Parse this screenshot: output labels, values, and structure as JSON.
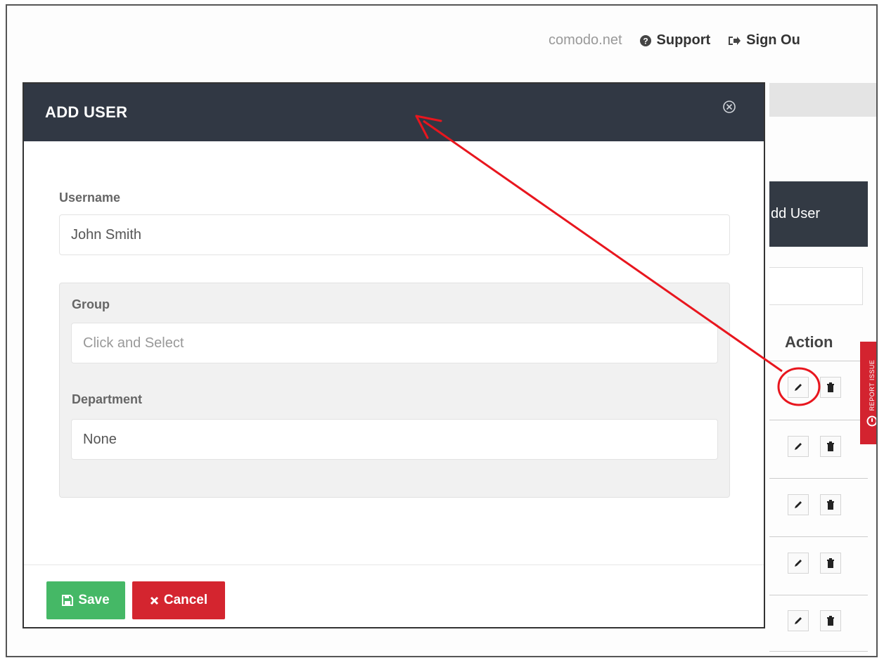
{
  "topnav": {
    "domain": "comodo.net",
    "support_label": "Support",
    "signout_label": "Sign Ou"
  },
  "background": {
    "add_user_label": "dd User",
    "action_header": "Action",
    "report_issue_label": "REPORT ISSUE",
    "row_count": 5
  },
  "modal": {
    "title": "ADD USER",
    "username": {
      "label": "Username",
      "value": "John Smith"
    },
    "group": {
      "label": "Group",
      "placeholder": "Click and Select"
    },
    "department": {
      "label": "Department",
      "value": "None"
    },
    "save_label": "Save",
    "cancel_label": "Cancel"
  },
  "colors": {
    "modal_header": "#313844",
    "save": "#45b866",
    "cancel": "#d4252f",
    "report": "#d3232f",
    "annotation": "#e8161e"
  },
  "icons": [
    "question-circle-icon",
    "sign-out-icon",
    "close-circle-icon",
    "floppy-disk-icon",
    "times-icon",
    "pencil-icon",
    "trash-icon"
  ]
}
